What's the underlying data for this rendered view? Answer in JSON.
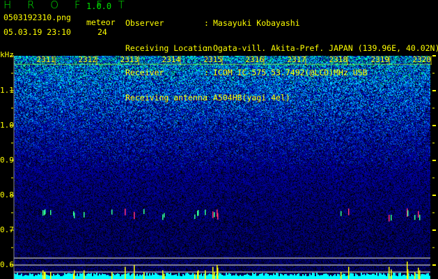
{
  "header": {
    "app_title": "H R O F F T",
    "version": "1.0.0",
    "filename": "0503192310.png",
    "datetime": "05.03.19 23:10",
    "meteor_label": "meteor",
    "meteor_count": "24"
  },
  "info": [
    {
      "key": "Observer",
      "value": "Masayuki Kobayashi"
    },
    {
      "key": "Receiving Location",
      "value": "Ogata-vill. Akita-Pref. JAPAN (139.96E, 40.02N)"
    },
    {
      "key": "Receiver",
      "value": "ICOM IC-575 53.7492(@LCD)MHz USB"
    },
    {
      "key": "Receiving antenna",
      "value": "A504HB(yagi 4el)"
    }
  ],
  "colors": {
    "text": "#ffff00",
    "title": "#00e000",
    "echo_bar": "#ffff00",
    "noise_floor": "#00ffff",
    "ref_lines": "#a0a0a0"
  },
  "chart_data": {
    "type": "heatmap",
    "ylabel": "kHz",
    "x_tick_labels": [
      "2311",
      "2312",
      "2313",
      "2314",
      "2315",
      "2316",
      "2317",
      "2318",
      "2319",
      "2320"
    ],
    "y_tick_labels": [
      "1.1",
      "1.0",
      "0.9",
      "0.8",
      "0.7",
      "0.6"
    ],
    "y_ticks": [
      1.1,
      1.0,
      0.9,
      0.8,
      0.7,
      0.6
    ],
    "ylim": [
      0.56,
      1.2
    ],
    "xlim": [
      "23:10:00",
      "23:20:00"
    ],
    "reference_lines_khz": [
      0.62,
      0.6,
      0.58
    ],
    "echo_band_khz": 0.745,
    "echoes": [
      {
        "time": "23:10:41",
        "strength": 0.5
      },
      {
        "time": "23:10:43",
        "strength": 0.4
      },
      {
        "time": "23:10:44",
        "strength": 0.4
      },
      {
        "time": "23:10:52",
        "strength": 0.4
      },
      {
        "time": "23:11:25",
        "strength": 0.3
      },
      {
        "time": "23:11:26",
        "strength": 0.5
      },
      {
        "time": "23:11:40",
        "strength": 0.5
      },
      {
        "time": "23:12:20",
        "strength": 0.4
      },
      {
        "time": "23:12:39",
        "strength": 0.7
      },
      {
        "time": "23:12:52",
        "strength": 0.8
      },
      {
        "time": "23:13:06",
        "strength": 0.4
      },
      {
        "time": "23:13:33",
        "strength": 0.5
      },
      {
        "time": "23:13:35",
        "strength": 0.3
      },
      {
        "time": "23:14:19",
        "strength": 0.3
      },
      {
        "time": "23:14:23",
        "strength": 0.45
      },
      {
        "time": "23:14:24",
        "strength": 0.5
      },
      {
        "time": "23:14:34",
        "strength": 0.5
      },
      {
        "time": "23:14:45",
        "strength": 0.7
      },
      {
        "time": "23:14:47",
        "strength": 0.4
      },
      {
        "time": "23:14:51",
        "strength": 0.8
      },
      {
        "time": "23:14:52",
        "strength": 0.65
      },
      {
        "time": "23:17:49",
        "strength": 0.4
      },
      {
        "time": "23:18:00",
        "strength": 0.7
      },
      {
        "time": "23:18:58",
        "strength": 0.7
      },
      {
        "time": "23:19:01",
        "strength": 0.55
      },
      {
        "time": "23:19:24",
        "strength": 1.0
      },
      {
        "time": "23:19:25",
        "strength": 0.55
      },
      {
        "time": "23:19:35",
        "strength": 0.4
      },
      {
        "time": "23:19:40",
        "strength": 0.65
      },
      {
        "time": "23:19:42",
        "strength": 0.5
      }
    ]
  }
}
